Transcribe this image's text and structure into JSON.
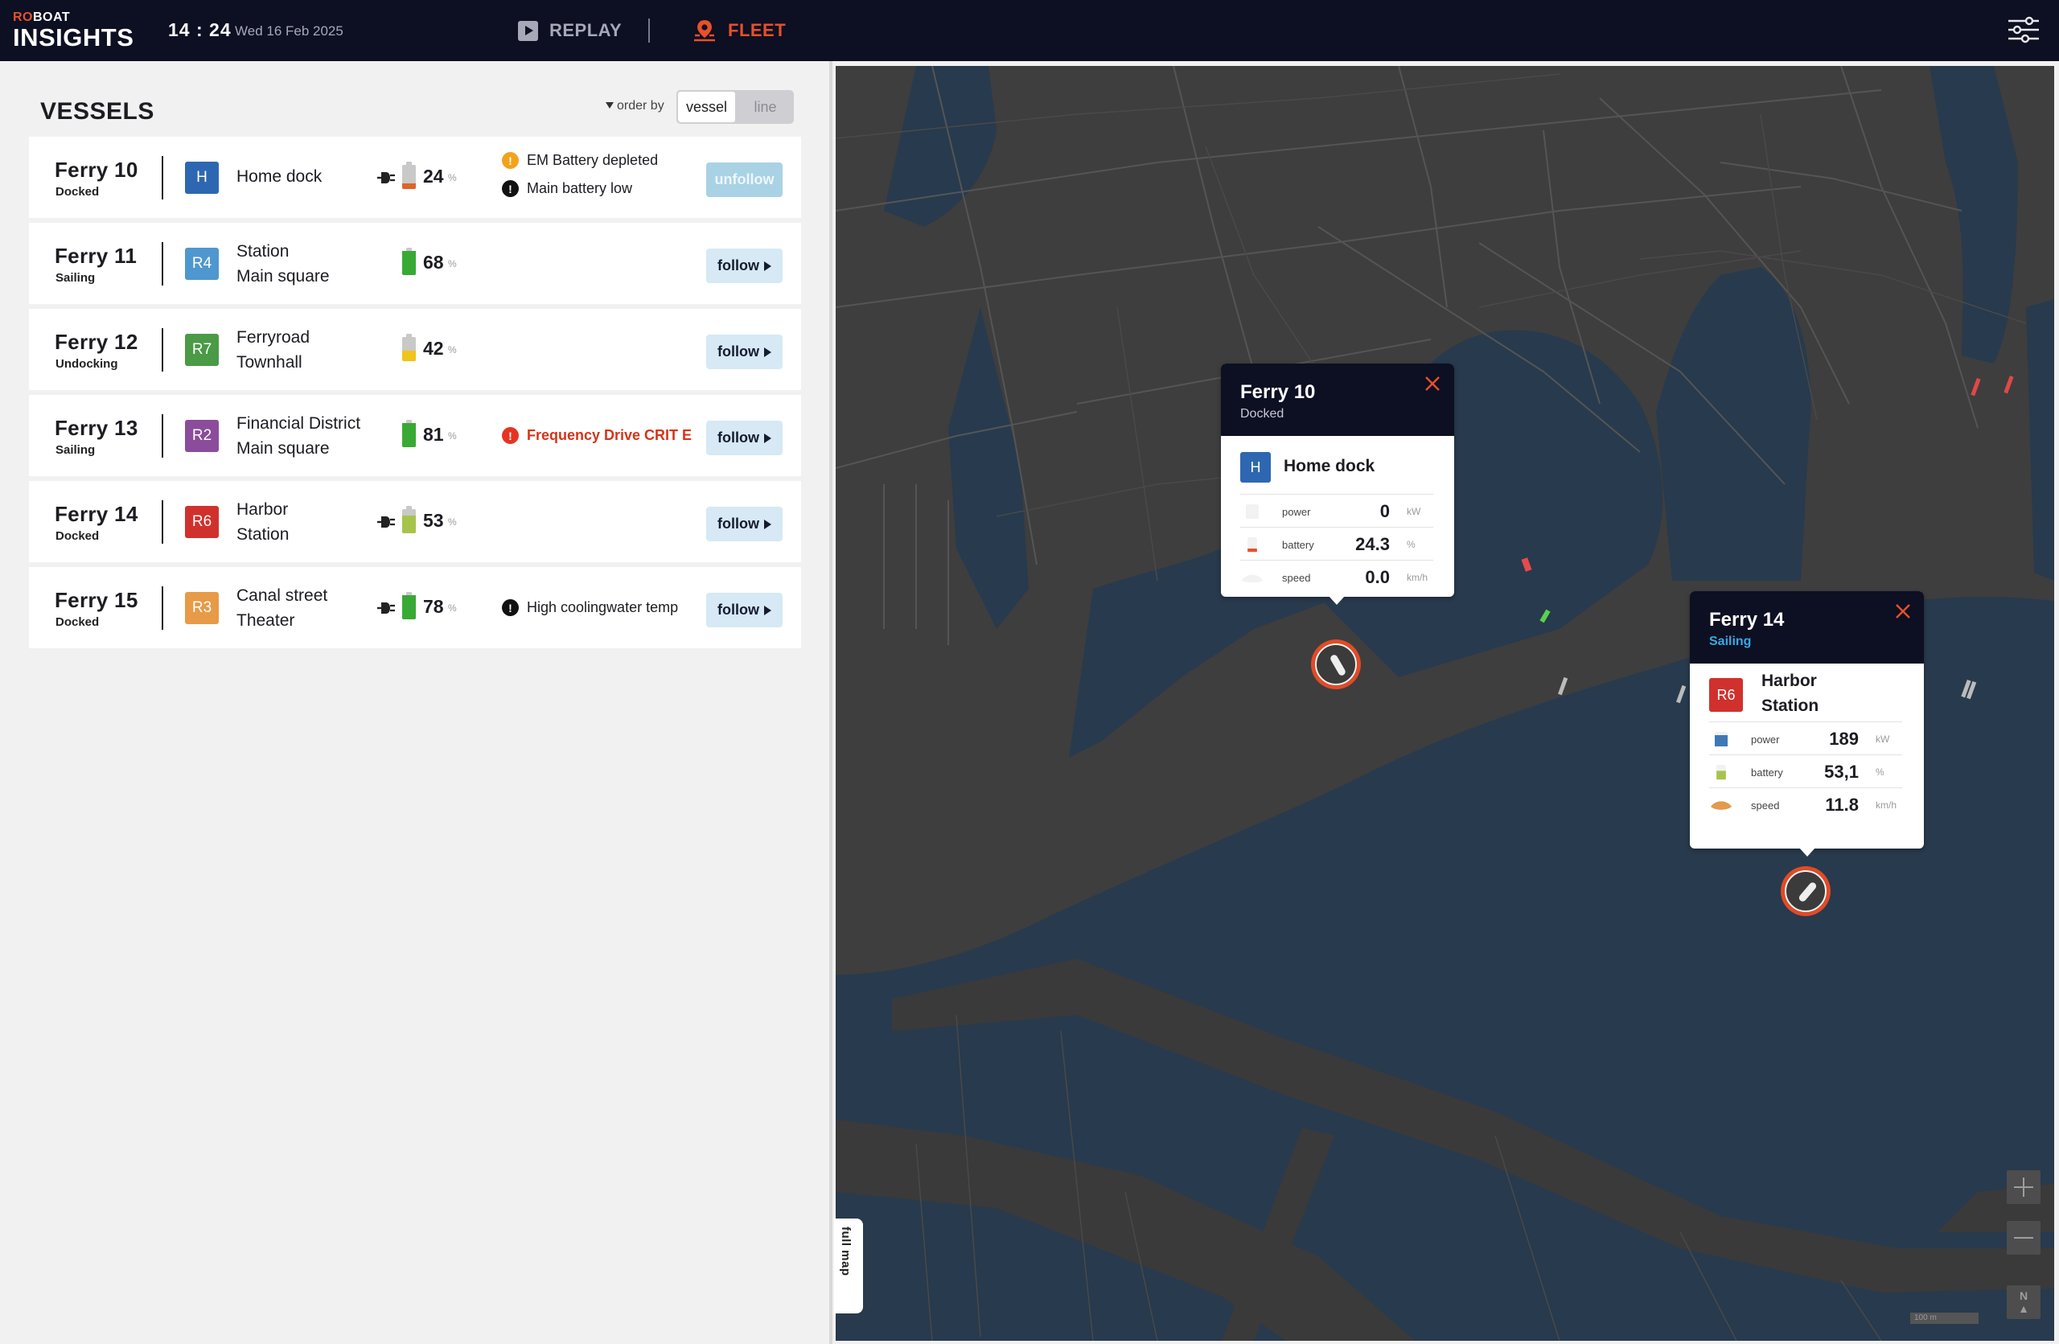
{
  "app": {
    "logo_top_accent": "RO",
    "logo_top_rest": "BOAT",
    "logo_bottom": "INSIGHTS"
  },
  "header": {
    "time": "14 : 24",
    "date": "Wed 16 Feb 2025",
    "replay_label": "REPLAY",
    "fleet_label": "FLEET",
    "replay_icon": "play-icon",
    "fleet_icon": "location-pin-icon",
    "settings_icon": "sliders-icon"
  },
  "panel": {
    "title": "VESSELS",
    "order_by_label": "order by",
    "order_options": [
      "vessel",
      "line"
    ],
    "order_selected": "vessel"
  },
  "vessels": [
    {
      "name": "Ferry 10",
      "state": "Docked",
      "line": "H",
      "line_color": "#2e67b1",
      "dest": [
        "Home dock"
      ],
      "plug": true,
      "battery": "24",
      "battery_fill": 0.24,
      "battery_color": "#e0632a",
      "alerts": [
        {
          "type": "warn",
          "text": "EM Battery depleted"
        },
        {
          "type": "info",
          "text": "Main battery low"
        }
      ],
      "action": "unfollow"
    },
    {
      "name": "Ferry 11",
      "state": "Sailing",
      "line": "R4",
      "line_color": "#4f97cf",
      "dest": [
        "Station",
        "Main square"
      ],
      "plug": false,
      "battery": "68",
      "battery_fill": 1.0,
      "battery_color": "#39a935",
      "alerts": [],
      "action": "follow"
    },
    {
      "name": "Ferry 12",
      "state": "Undocking",
      "line": "R7",
      "line_color": "#4a9a46",
      "dest": [
        "Ferryroad",
        "Townhall"
      ],
      "plug": false,
      "battery": "42",
      "battery_fill": 0.42,
      "battery_color": "#f0c419",
      "alerts": [],
      "action": "follow"
    },
    {
      "name": "Ferry 13",
      "state": "Sailing",
      "line": "R2",
      "line_color": "#8b4c9c",
      "dest": [
        "Financial District",
        "Main square"
      ],
      "plug": false,
      "battery": "81",
      "battery_fill": 1.0,
      "battery_color": "#39a935",
      "alerts": [
        {
          "type": "crit",
          "text": "Frequency Drive CRIT E"
        }
      ],
      "action": "follow"
    },
    {
      "name": "Ferry 14",
      "state": "Docked",
      "line": "R6",
      "line_color": "#d0312d",
      "dest": [
        "Harbor",
        "Station"
      ],
      "plug": true,
      "battery": "53",
      "battery_fill": 0.75,
      "battery_color": "#a6c44c",
      "alerts": [],
      "action": "follow"
    },
    {
      "name": "Ferry 15",
      "state": "Docked",
      "line": "R3",
      "line_color": "#e79a47",
      "dest": [
        "Canal street",
        "Theater"
      ],
      "plug": true,
      "battery": "78",
      "battery_fill": 1.0,
      "battery_color": "#39a935",
      "alerts": [
        {
          "type": "info",
          "text": "High coolingwater temp"
        }
      ],
      "action": "follow"
    }
  ],
  "popups": [
    {
      "title": "Ferry 10",
      "status": "Docked",
      "line": "H",
      "line_color": "#2e67b1",
      "dest": [
        "Home dock"
      ],
      "metrics": [
        {
          "label": "power",
          "value": "0",
          "unit": "kW",
          "icon": "power-gauge-icon"
        },
        {
          "label": "battery",
          "value": "24.3",
          "unit": "%",
          "icon": "battery-icon"
        },
        {
          "label": "speed",
          "value": "0.0",
          "unit": "km/h",
          "icon": "speed-gauge-icon"
        }
      ]
    },
    {
      "title": "Ferry 14",
      "status": "Sailing",
      "line": "R6",
      "line_color": "#d0312d",
      "dest": [
        "Harbor",
        "Station"
      ],
      "metrics": [
        {
          "label": "power",
          "value": "189",
          "unit": "kW",
          "icon": "power-gauge-icon"
        },
        {
          "label": "battery",
          "value": "53,1",
          "unit": "%",
          "icon": "battery-icon"
        },
        {
          "label": "speed",
          "value": "11.8",
          "unit": "km/h",
          "icon": "speed-gauge-icon"
        }
      ]
    }
  ],
  "map": {
    "full_map_label": "full map",
    "north_label": "N",
    "scale_label": "100 m",
    "zoom_in_icon": "plus-icon",
    "zoom_out_icon": "minus-icon"
  },
  "colors": {
    "accent": "#e8502b",
    "nav_bg": "#0d0f22",
    "water": "#283a4d",
    "land": "#3e3e3e"
  }
}
